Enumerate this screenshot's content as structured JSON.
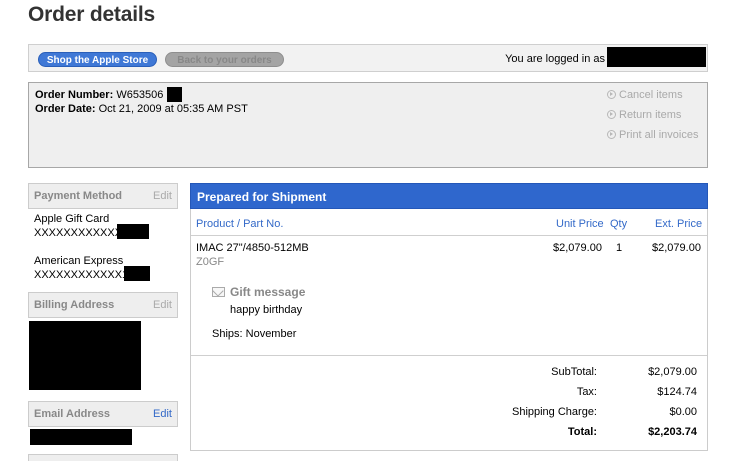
{
  "page": {
    "title": "Order details"
  },
  "topbar": {
    "shop_button": "Shop the Apple Store",
    "back_button": "Back to your orders",
    "logged_in_label": "You are logged in as"
  },
  "order": {
    "number_label": "Order Number:",
    "number_value": "W653506",
    "date_label": "Order Date:",
    "date_value": "Oct 21, 2009 at 05:35 AM PST",
    "actions": [
      "Cancel items",
      "Return items",
      "Print all invoices"
    ]
  },
  "sidebar": {
    "payment": {
      "title": "Payment Method",
      "edit": "Edit",
      "methods": [
        {
          "name": "Apple Gift Card",
          "number": "XXXXXXXXXXXX"
        },
        {
          "name": "American Express",
          "number": "XXXXXXXXXXXX1"
        }
      ]
    },
    "billing": {
      "title": "Billing Address",
      "edit": "Edit"
    },
    "email": {
      "title": "Email Address",
      "edit": "Edit"
    }
  },
  "shipment": {
    "title": "Prepared for Shipment",
    "columns": {
      "product": "Product / Part No.",
      "unit_price": "Unit Price",
      "qty": "Qty",
      "ext_price": "Ext. Price"
    },
    "item": {
      "name": "IMAC 27\"/4850-512MB",
      "part": "Z0GF",
      "unit_price": "$2,079.00",
      "qty": "1",
      "ext_price": "$2,079.00",
      "gift_label": "Gift message",
      "gift_text": "happy birthday",
      "ships": "Ships: November"
    },
    "summary": {
      "subtotal_label": "SubTotal:",
      "subtotal": "$2,079.00",
      "tax_label": "Tax:",
      "tax": "$124.74",
      "shipping_label": "Shipping Charge:",
      "shipping": "$0.00",
      "total_label": "Total:",
      "total": "$2,203.74"
    }
  },
  "colors": {
    "accent": "#2f67cd",
    "link": "#3369c8",
    "pill_gray": "#a4a4a4"
  }
}
